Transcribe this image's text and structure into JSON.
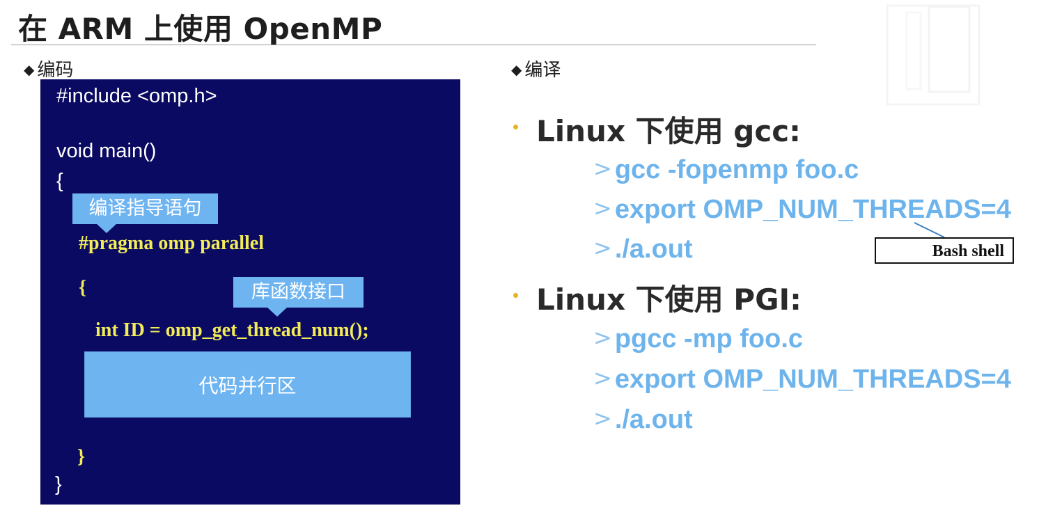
{
  "slide": {
    "title": "在 ARM 上使用 OpenMP"
  },
  "left": {
    "section_label": "编码",
    "code": {
      "include": "#include <omp.h>",
      "main_sig": "void main()",
      "open_brace": "{",
      "pragma": "#pragma omp parallel",
      "inner_open": "{",
      "thread_call": "int ID = omp_get_thread_num();",
      "inner_close": "}",
      "close_brace": "}"
    },
    "callout_directive": "编译指导语句",
    "callout_library": "库函数接口",
    "parallel_region": "代码并行区"
  },
  "right": {
    "section_label": "编译",
    "groups": [
      {
        "heading": "Linux 下使用 gcc:",
        "commands": [
          "gcc -fopenmp foo.c",
          "export OMP_NUM_THREADS=4",
          "./a.out"
        ]
      },
      {
        "heading": "Linux 下使用 PGI:",
        "commands": [
          "pgcc -mp foo.c",
          "export OMP_NUM_THREADS=4",
          "./a.out"
        ]
      }
    ],
    "annotation": "Bash shell"
  },
  "symbols": {
    "diamond": "◆",
    "cmd_arrow": ">"
  },
  "colors": {
    "code_bg": "#0a0a62",
    "code_keyword": "#f2ec58",
    "callout": "#6eb4f0",
    "command": "#6eb4ec",
    "bullet": "#e6b422"
  }
}
